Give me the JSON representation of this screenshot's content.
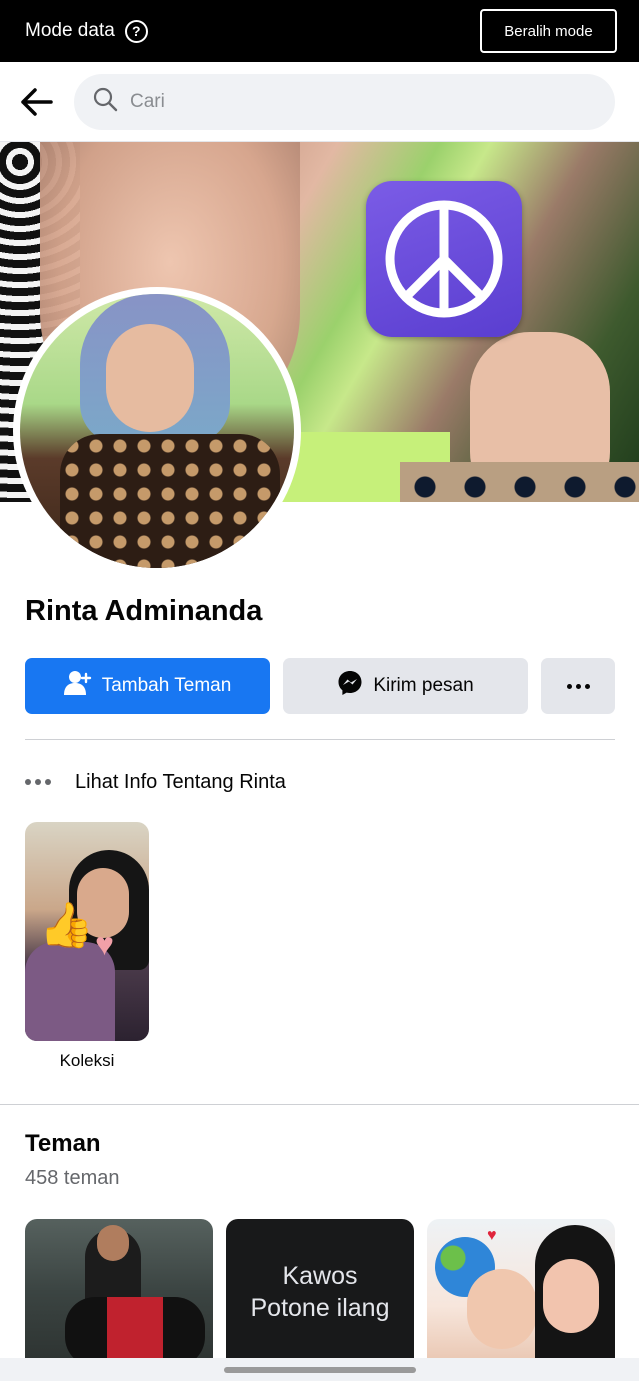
{
  "mode_bar": {
    "label": "Mode data",
    "help_icon": "?",
    "switch_button": "Beralih mode"
  },
  "search": {
    "placeholder": "Cari"
  },
  "profile": {
    "name": "Rinta Adminanda"
  },
  "actions": {
    "add_friend": "Tambah Teman",
    "message": "Kirim pesan",
    "more_icon": "more-horizontal-icon"
  },
  "info": {
    "label": "Lihat Info Tentang Rinta"
  },
  "collection": {
    "label": "Koleksi"
  },
  "friends": {
    "title": "Teman",
    "count": "458 teman",
    "cards": [
      {
        "type": "photo"
      },
      {
        "type": "text",
        "text": "Kawos\nPotone ilang"
      },
      {
        "type": "photo"
      }
    ]
  },
  "colors": {
    "accent": "#1877f2",
    "button_secondary": "#e4e6eb",
    "search_bg": "#f0f2f5",
    "peace_tile": "#6a4adb"
  }
}
